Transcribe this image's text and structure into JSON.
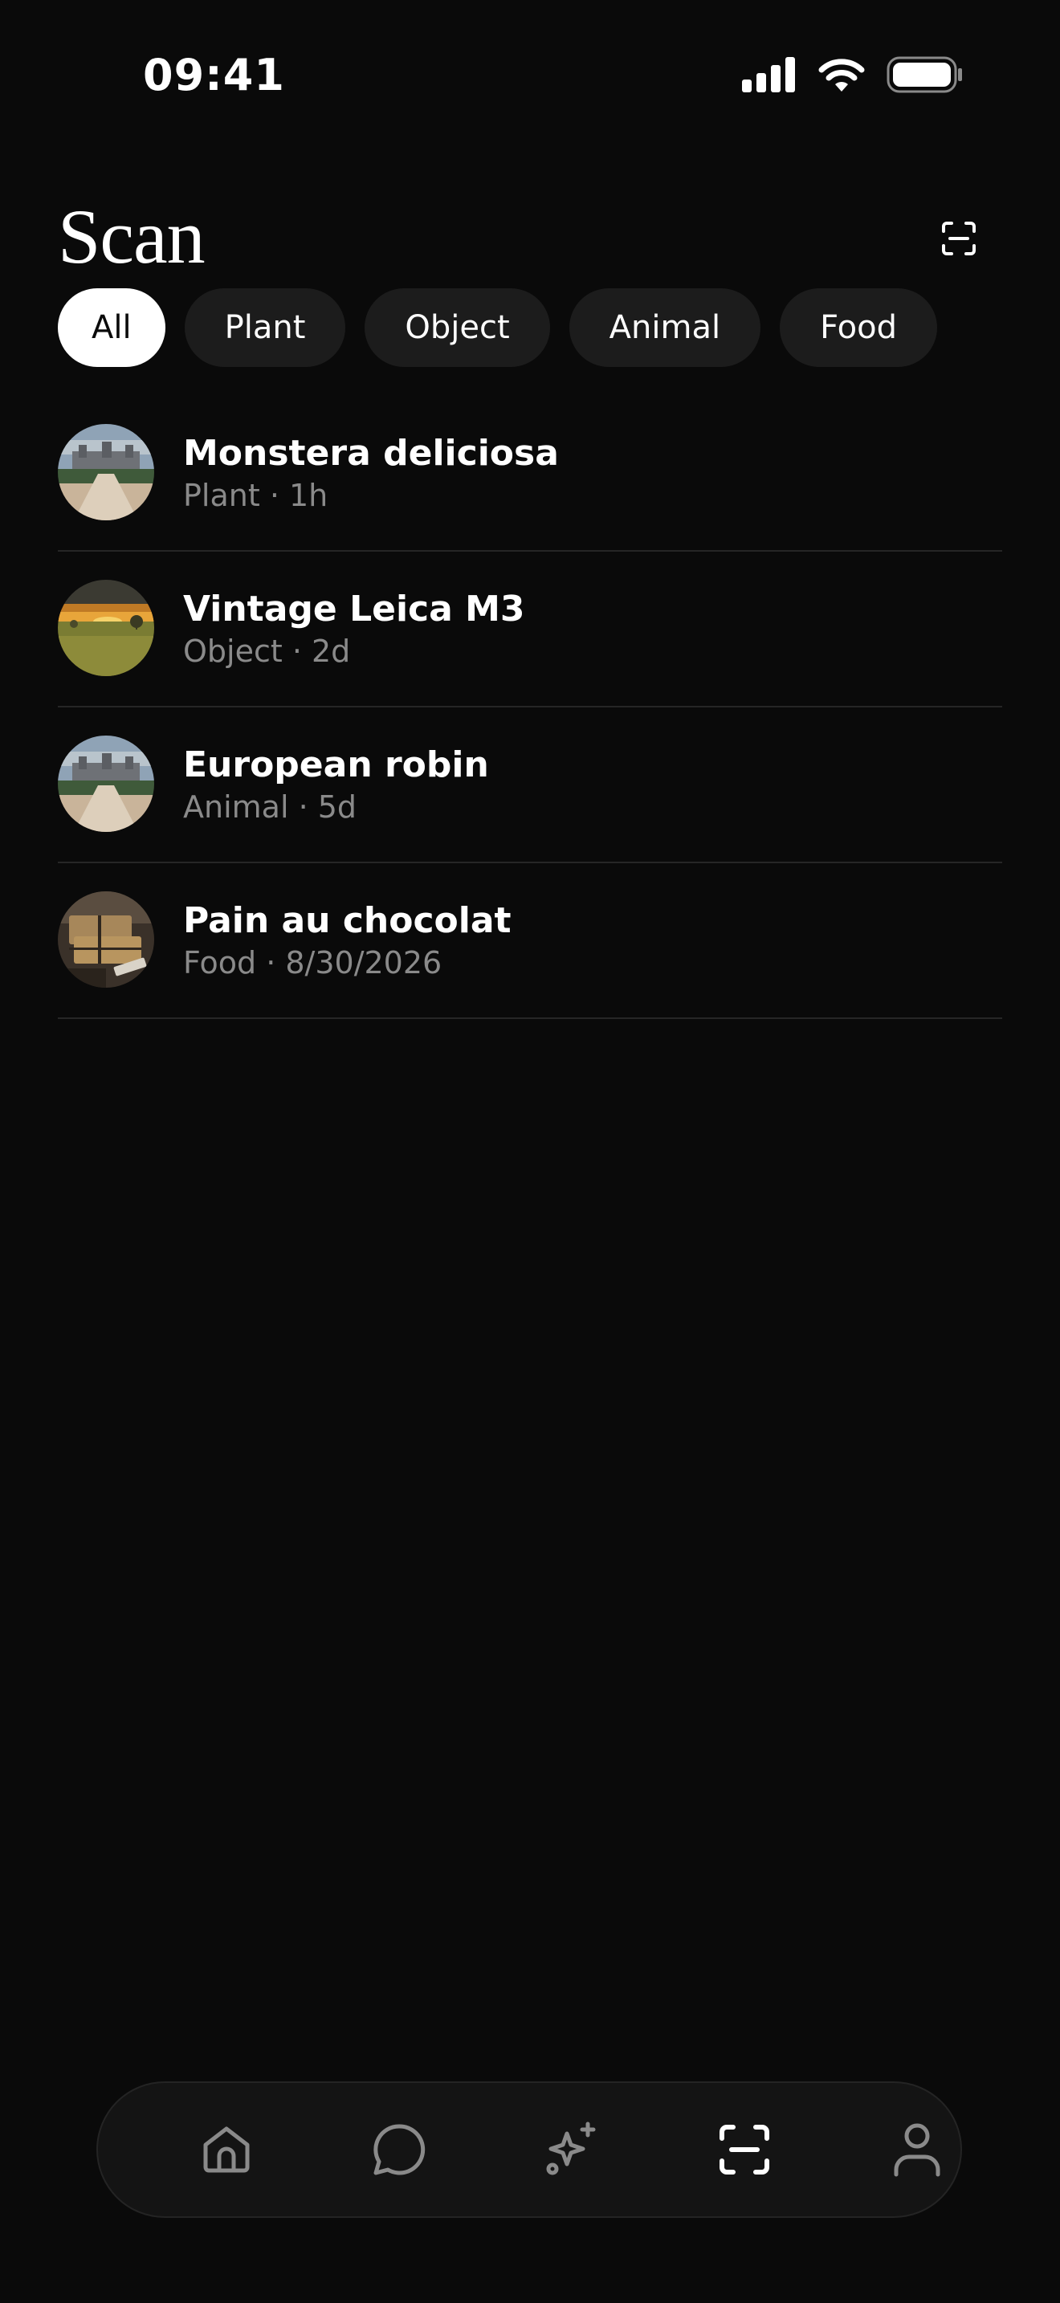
{
  "status_bar": {
    "time": "09:41",
    "icons": [
      "cellular-signal-icon",
      "wifi-icon",
      "battery-icon"
    ]
  },
  "header": {
    "title": "Scan",
    "action_icon": "scan-icon"
  },
  "filters": [
    {
      "label": "All",
      "active": true
    },
    {
      "label": "Plant",
      "active": false
    },
    {
      "label": "Object",
      "active": false
    },
    {
      "label": "Animal",
      "active": false
    },
    {
      "label": "Food",
      "active": false
    }
  ],
  "scans": [
    {
      "title": "Monstera deliciosa",
      "meta": "Plant · 1h",
      "thumbnail": "chateau-photo"
    },
    {
      "title": "Vintage Leica M3",
      "meta": "Object · 2d",
      "thumbnail": "sunset-field-photo"
    },
    {
      "title": "European robin",
      "meta": "Animal · 5d",
      "thumbnail": "chateau-photo"
    },
    {
      "title": "Pain au chocolat",
      "meta": "Food · 8/30/2026",
      "thumbnail": "parcels-photo"
    }
  ],
  "tab_bar": {
    "tabs": [
      {
        "icon": "home-icon",
        "active": false
      },
      {
        "icon": "chat-icon",
        "active": false
      },
      {
        "icon": "sparkles-icon",
        "active": false
      },
      {
        "icon": "scan-icon",
        "active": true
      },
      {
        "icon": "profile-icon",
        "active": false
      }
    ]
  },
  "colors": {
    "background": "#0a0a0a",
    "chip_background": "#1c1c1c",
    "chip_active_background": "#ffffff",
    "divider": "#262626",
    "secondary_text": "#8a8a8a",
    "tab_inactive": "#8a8a8a",
    "tab_active": "#ffffff"
  }
}
